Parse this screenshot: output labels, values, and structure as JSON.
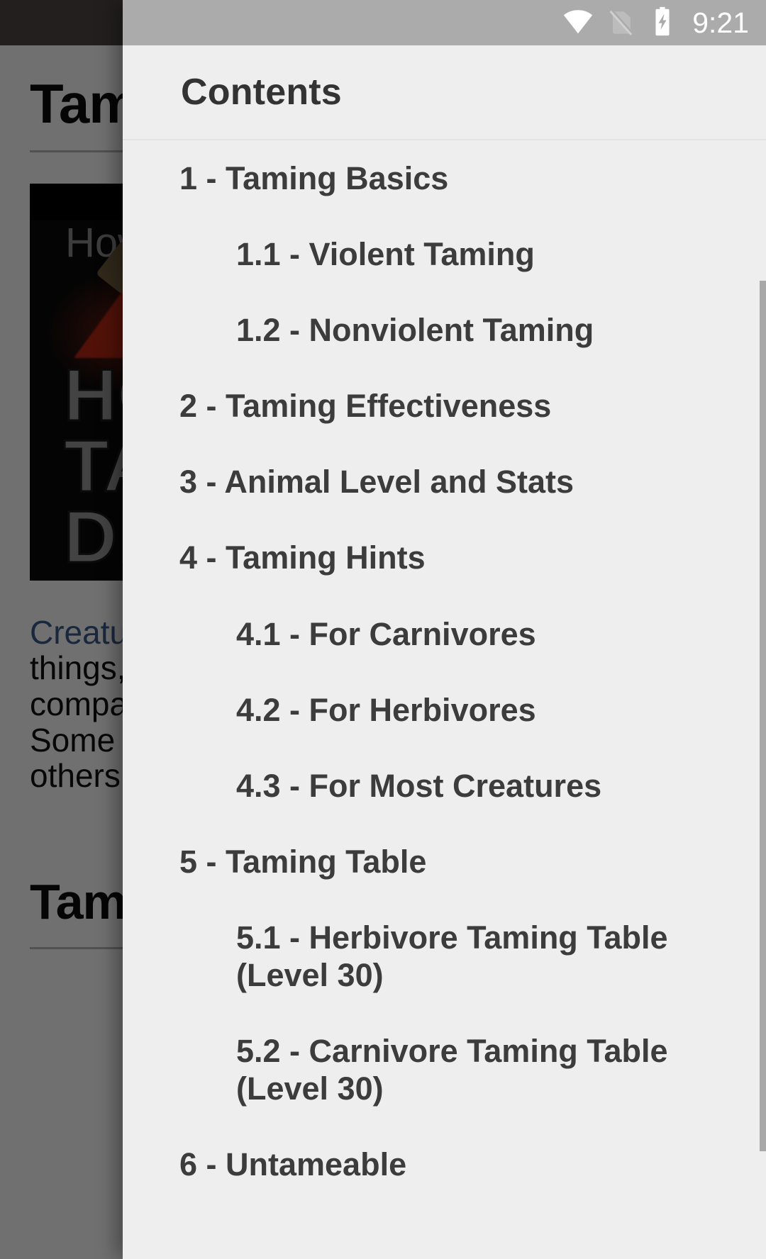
{
  "status_bar": {
    "time": "9:21",
    "icons": [
      "wifi-icon",
      "no-sim-icon",
      "battery-charging-icon"
    ]
  },
  "drawer": {
    "title": "Contents",
    "toc": [
      {
        "label": "1 - Taming Basics",
        "level": 1
      },
      {
        "label": "1.1 - Violent Taming",
        "level": 2
      },
      {
        "label": "1.2 - Nonviolent Taming",
        "level": 2
      },
      {
        "label": "2 - Taming Effectiveness",
        "level": 1
      },
      {
        "label": "3 - Animal Level and Stats",
        "level": 1
      },
      {
        "label": "4 - Taming Hints",
        "level": 1
      },
      {
        "label": "4.1 - For Carnivores",
        "level": 2
      },
      {
        "label": "4.2 - For Herbivores",
        "level": 2
      },
      {
        "label": "4.3 - For Most Creatures",
        "level": 2
      },
      {
        "label": "5 - Taming Table",
        "level": 1
      },
      {
        "label": "5.1 - Herbivore Taming Table (Level 30)",
        "level": 2
      },
      {
        "label": "5.2 - Carnivore Taming Table (Level 30)",
        "level": 2
      },
      {
        "label": "6 - Untameable",
        "level": 1
      }
    ]
  },
  "background_page": {
    "heading": "Taming",
    "thumbnail": {
      "overline": "How to",
      "big_text": "HOW TO\nTAME\nDINOS"
    },
    "paragraph_link": "Creatures",
    "paragraph_rest": " can be tamed and used for many things, such as riding animals, battle companions, resource storage, and harvesting. Some creatures must be placed in a trap, while others will take much longer to tame otherwise.",
    "section_heading": "Taming Basics"
  },
  "colors": {
    "drawer_bg": "#eeeeee",
    "status_bar_bg": "#ababab",
    "toc_text": "#3c3c3c",
    "title_text": "#333333",
    "scrollbar": "#a8a8a8",
    "link": "#3b5b8c"
  }
}
